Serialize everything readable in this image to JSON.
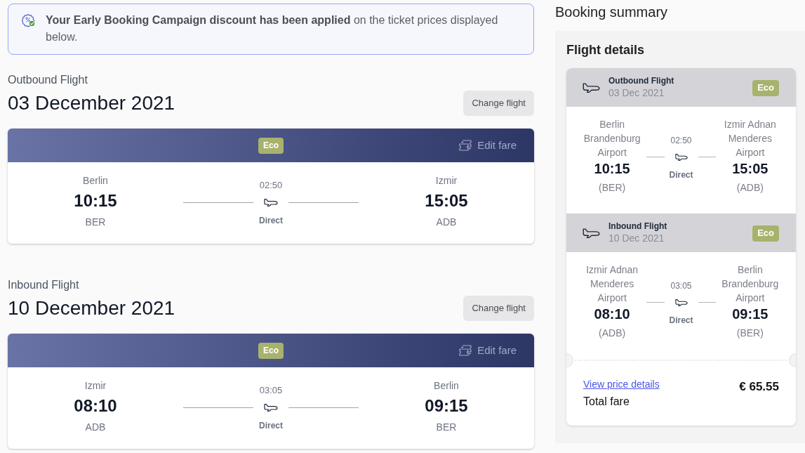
{
  "banner": {
    "text": "**Your Early Booking Campaign discount has been applied** on the ticket prices displayed below."
  },
  "flights": [
    {
      "label": "Outbound Flight",
      "date": "03 December 2021",
      "change_button": "Change flight",
      "fare": "Eco",
      "edit_fare": "Edit fare",
      "departure": {
        "city": "Berlin",
        "time": "10:15",
        "code": "BER"
      },
      "duration": "02:50",
      "stops": "Direct",
      "arrival": {
        "city": "Izmir",
        "time": "15:05",
        "code": "ADB"
      }
    },
    {
      "label": "Inbound Flight",
      "date": "10 December 2021",
      "change_button": "Change flight",
      "fare": "Eco",
      "edit_fare": "Edit fare",
      "departure": {
        "city": "Izmir",
        "time": "08:10",
        "code": "ADB"
      },
      "duration": "03:05",
      "stops": "Direct",
      "arrival": {
        "city": "Berlin",
        "time": "09:15",
        "code": "BER"
      }
    }
  ],
  "summary": {
    "title": "Booking summary",
    "panel_title": "Flight details",
    "legs": [
      {
        "label": "Outbound Flight",
        "date": "03 Dec 2021",
        "fare": "Eco",
        "departure": {
          "airport": "Berlin Brandenburg Airport",
          "time": "10:15",
          "code": "(BER)"
        },
        "duration": "02:50",
        "stops": "Direct",
        "arrival": {
          "airport": "Izmir Adnan Menderes Airport",
          "time": "15:05",
          "code": "(ADB)"
        }
      },
      {
        "label": "Inbound Flight",
        "date": "10 Dec 2021",
        "fare": "Eco",
        "departure": {
          "airport": "Izmir Adnan Menderes Airport",
          "time": "08:10",
          "code": "(ADB)"
        },
        "duration": "03:05",
        "stops": "Direct",
        "arrival": {
          "airport": "Berlin Brandenburg Airport",
          "time": "09:15",
          "code": "(BER)"
        }
      }
    ],
    "price_link": "View price details",
    "total": "€ 65.55",
    "total_label": "Total fare"
  }
}
